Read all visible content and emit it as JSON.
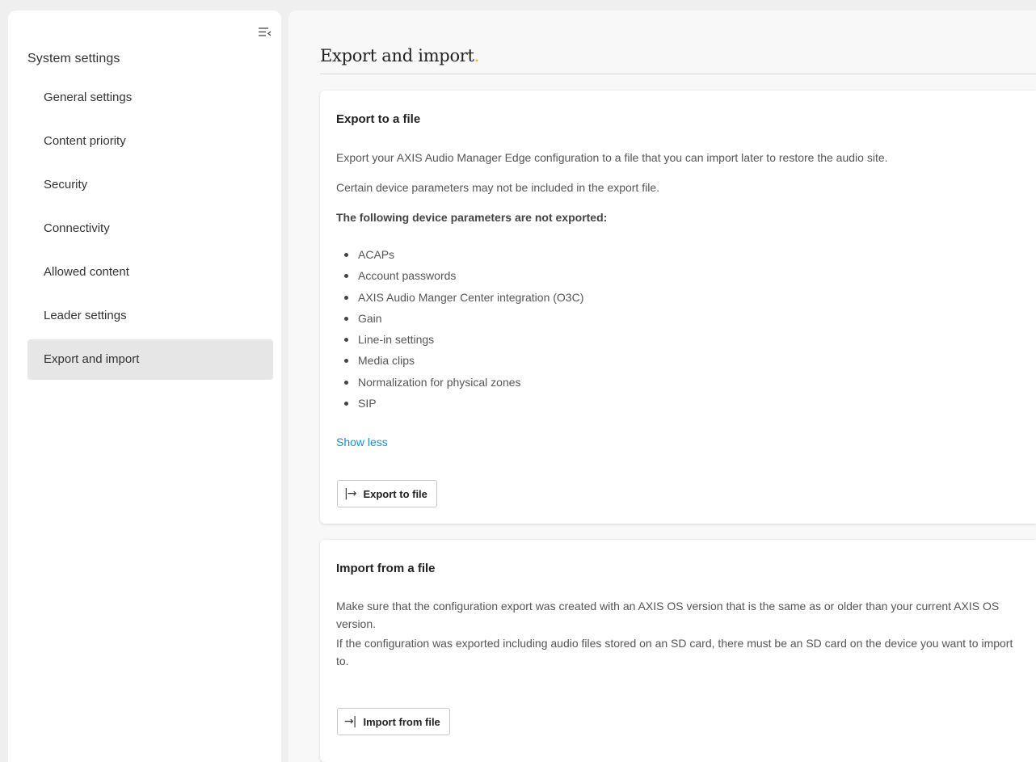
{
  "sidebar": {
    "title": "System settings",
    "collapse_icon": "collapse-sidebar-icon",
    "items": [
      {
        "label": "General settings",
        "active": false
      },
      {
        "label": "Content priority",
        "active": false
      },
      {
        "label": "Security",
        "active": false
      },
      {
        "label": "Connectivity",
        "active": false
      },
      {
        "label": "Allowed content",
        "active": false
      },
      {
        "label": "Leader settings",
        "active": false
      },
      {
        "label": "Export and import",
        "active": true
      }
    ]
  },
  "page": {
    "title": "Export and import",
    "title_dot": ".",
    "accent_color": "#f0b400"
  },
  "export_card": {
    "title": "Export to a file",
    "description": "Export your AXIS Audio Manager Edge configuration to a file that you can import later to restore the audio site.",
    "note": "Certain device parameters may not be included in the export file.",
    "list_heading": "The following device parameters are not exported:",
    "parameters": [
      "ACAPs",
      "Account passwords",
      "AXIS Audio Manger Center integration (O3C)",
      "Gain",
      "Line-in settings",
      "Media clips",
      "Normalization for physical zones",
      "SIP"
    ],
    "toggle_link": "Show less",
    "link_color": "#1a8fc9",
    "button_icon": "|→",
    "button_label": "Export to file"
  },
  "import_card": {
    "title": "Import from a file",
    "description": "Make sure that the configuration export was created with an AXIS OS version that is the same as or older than your current AXIS OS version.",
    "note": "If the configuration was exported including audio files stored on an SD card, there must be an SD card on the device you want to import to.",
    "button_icon": "→|",
    "button_label": "Import from file"
  }
}
